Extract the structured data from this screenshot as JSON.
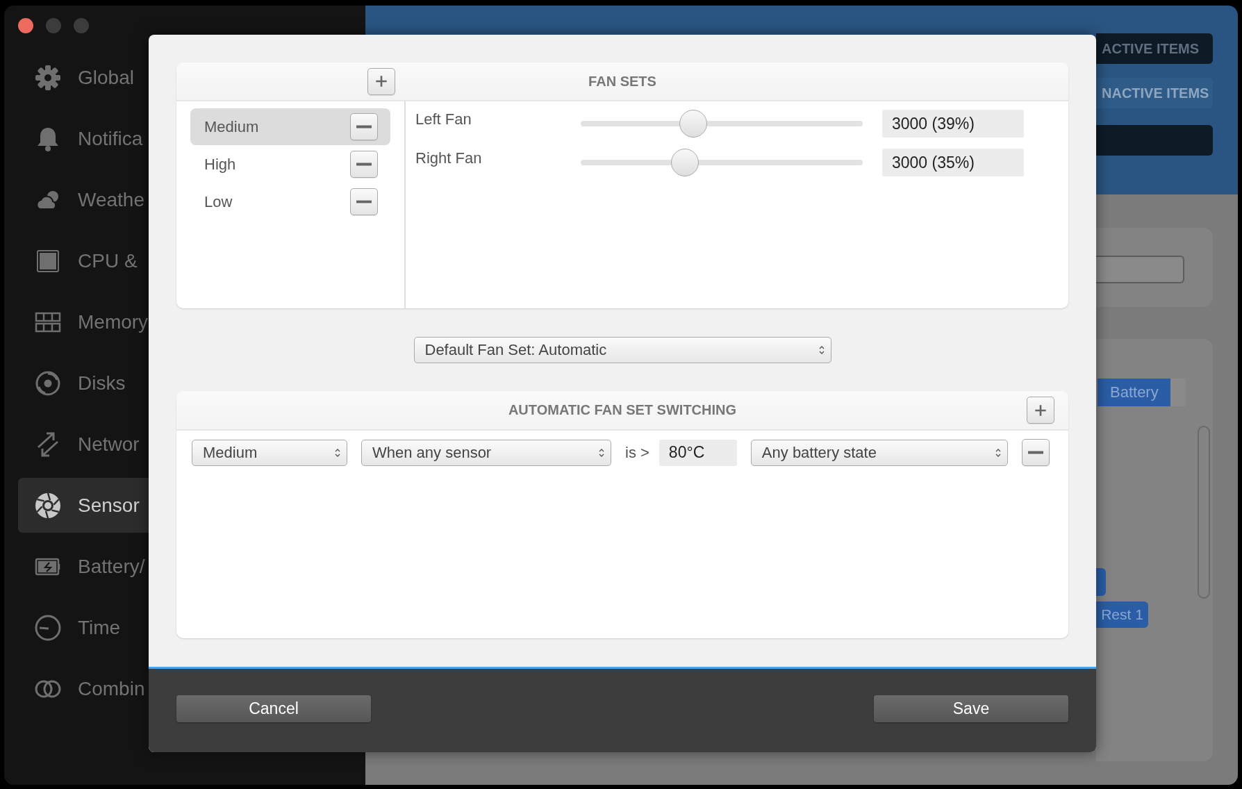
{
  "sidebar": {
    "items": [
      {
        "label": "Global",
        "selected": false
      },
      {
        "label": "Notifica",
        "selected": false
      },
      {
        "label": "Weathe",
        "selected": false
      },
      {
        "label": "CPU &",
        "selected": false
      },
      {
        "label": "Memory",
        "selected": false
      },
      {
        "label": "Disks",
        "selected": false
      },
      {
        "label": "Networ",
        "selected": false
      },
      {
        "label": "Sensor",
        "selected": true
      },
      {
        "label": "Battery/",
        "selected": false
      },
      {
        "label": "Time",
        "selected": false
      },
      {
        "label": "Combin",
        "selected": false
      }
    ]
  },
  "main": {
    "tabs": [
      {
        "label": "ACTIVE ITEMS",
        "selected": true
      },
      {
        "label": "NACTIVE ITEMS",
        "selected": false
      }
    ],
    "dropdown": "Battery",
    "button": "Rest 1"
  },
  "dialog": {
    "fan_sets": {
      "title": "FAN SETS",
      "sets": [
        {
          "name": "Medium",
          "selected": true
        },
        {
          "name": "High",
          "selected": false
        },
        {
          "name": "Low",
          "selected": false
        }
      ],
      "fans": [
        {
          "name": "Left Fan",
          "level": 0.4,
          "value": "3000 (39%)"
        },
        {
          "name": "Right Fan",
          "level": 0.37,
          "value": "3000 (35%)"
        }
      ]
    },
    "default_fan_set": "Default Fan Set: Automatic",
    "automatic_switching": {
      "title": "AUTOMATIC FAN SET SWITCHING",
      "rules": [
        {
          "fan_set": "Medium",
          "condition": "When any sensor",
          "operator": "is >",
          "threshold": "80°C",
          "battery": "Any battery state"
        }
      ]
    },
    "buttons": {
      "cancel": "Cancel",
      "save": "Save"
    }
  }
}
